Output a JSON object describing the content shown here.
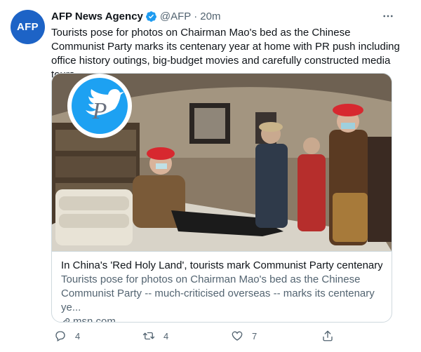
{
  "author": {
    "avatar_text": "AFP",
    "name": "AFP News Agency",
    "handle": "@AFP",
    "separator": "·",
    "time": "20m",
    "more_icon": "more-horizontal-icon"
  },
  "tweet": {
    "text": "Tourists pose for photos on Chairman Mao's bed as the Chinese Communist Party marks its centenary year at home with PR push including office history outings, big-budget movies and carefully constructed media tours"
  },
  "card": {
    "title": "In China's 'Red Holy Land', tourists mark Communist Party centenary",
    "description": "Tourists pose for photos on Chairman Mao's bed as the Chinese Communist Party -- much-criticised overseas -- marks its centenary ye...",
    "domain": "msn.com",
    "watermark_letter": "P"
  },
  "actions": {
    "reply_count": "4",
    "retweet_count": "4",
    "like_count": "7"
  },
  "colors": {
    "accent": "#1d9bf0",
    "avatar_bg": "#1d63c6",
    "text_primary": "#0f1419",
    "text_secondary": "#536471",
    "border": "#cfd9de"
  }
}
